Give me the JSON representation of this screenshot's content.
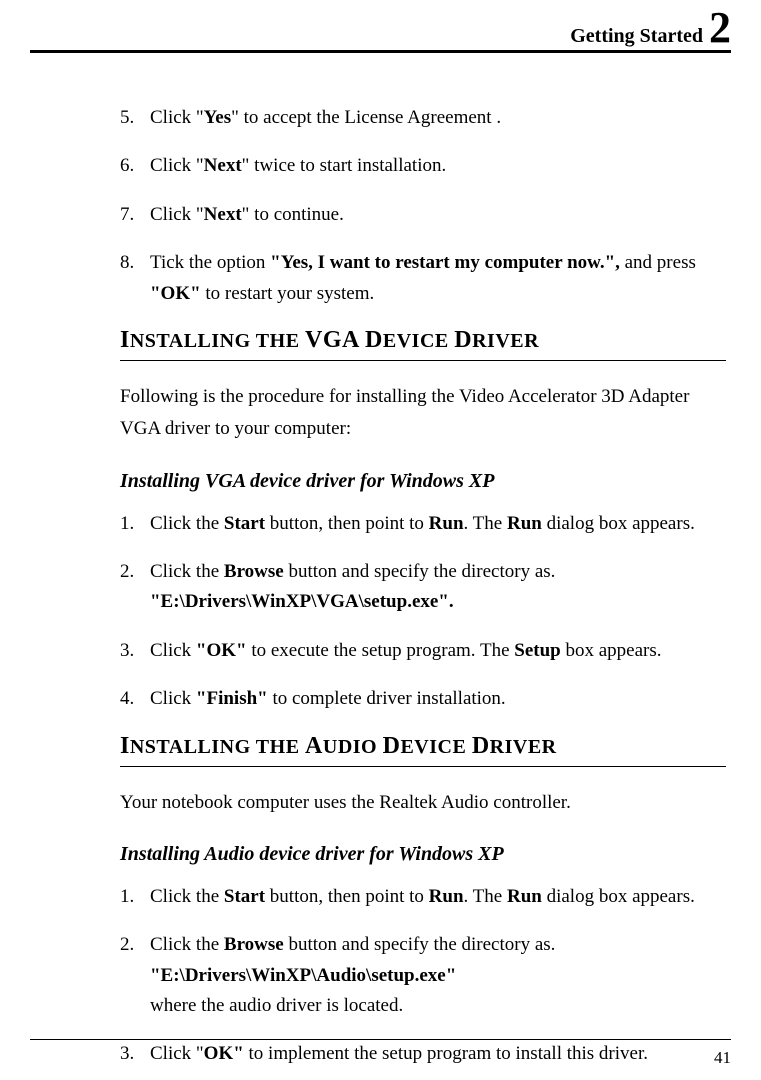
{
  "header": {
    "title": "Getting Started",
    "chapter": "2"
  },
  "steps_top": [
    {
      "num": "5.",
      "text": "Click \"<b>Yes</b>\" to accept the License Agreement ."
    },
    {
      "num": "6.",
      "text": "Click \"<b>Next</b>\" twice to start installation."
    },
    {
      "num": "7.",
      "text": "Click \"<b>Next</b>\" to continue."
    },
    {
      "num": "8.",
      "text": "Tick the option <b>\"Yes, I want to restart my computer now.\",</b> and press <b>\"OK\"</b> to restart your system."
    }
  ],
  "section1": {
    "heading_parts": [
      "I",
      "NSTALLING THE ",
      "VGA D",
      "EVICE ",
      "D",
      "RIVER"
    ],
    "intro": "Following is the procedure for installing the Video Accelerator 3D Adapter VGA driver to your computer:",
    "subheading": "Installing VGA device driver for Windows XP",
    "steps": [
      {
        "num": "1.",
        "text": "Click the <b>Start</b> button, then point to <b>Run</b>. The <b>Run</b> dialog box appears."
      },
      {
        "num": "2.",
        "text": "Click the <b>Browse</b> button and specify the directory as. <b>\"E:\\Drivers\\WinXP\\VGA\\setup.exe\".</b>"
      },
      {
        "num": "3.",
        "text": "Click <b>\"OK\"</b> to execute the setup program. The <b>Setup</b> box appears."
      },
      {
        "num": "4.",
        "text": "Click <b>\"Finish\"</b> to complete driver installation."
      }
    ]
  },
  "section2": {
    "heading_parts": [
      "I",
      "NSTALLING THE ",
      "A",
      "UDIO ",
      "D",
      "EVICE ",
      "D",
      "RIVER"
    ],
    "intro": "Your notebook computer uses the Realtek Audio controller.",
    "subheading": "Installing Audio device driver for Windows XP",
    "steps": [
      {
        "num": "1.",
        "text": "Click the <b>Start</b> button, then point to <b>Run</b>. The <b>Run</b> dialog box appears."
      },
      {
        "num": "2.",
        "text": "Click the <b>Browse</b> button and specify the directory as. <b>\"E:\\Drivers\\WinXP\\Audio\\setup.exe\"</b><br>where the audio driver is located."
      },
      {
        "num": "3.",
        "text": "Click \"<b>OK\"</b> to implement the setup program to install this driver."
      }
    ]
  },
  "page_number": "41"
}
